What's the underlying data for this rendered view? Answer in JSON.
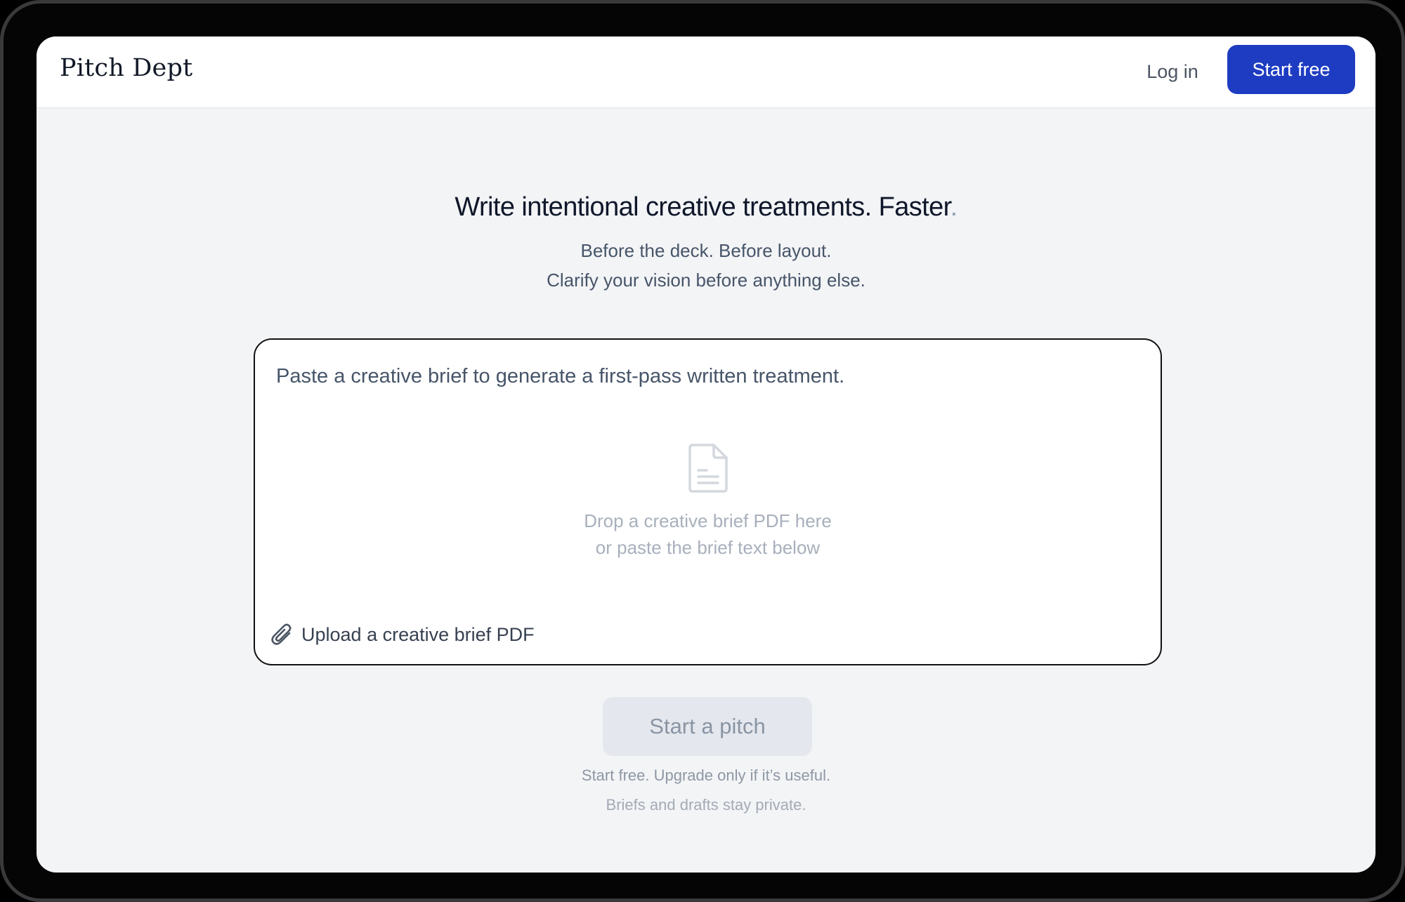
{
  "header": {
    "brand": "Pitch Dept",
    "login_label": "Log in",
    "start_free_label": "Start free"
  },
  "hero": {
    "headline": "Write intentional creative treatments. Faster",
    "headline_dot": ".",
    "subline_1": "Before the deck. Before layout.",
    "subline_2": "Clarify your vision before anything else."
  },
  "brief": {
    "placeholder": "Paste a creative brief to generate a first-pass written treatment.",
    "value": "",
    "drop_line_1": "Drop a creative brief PDF here",
    "drop_line_2": "or paste the brief text below",
    "upload_label": "Upload a creative brief PDF",
    "doc_icon": "document-icon",
    "upload_icon": "paperclip-icon"
  },
  "cta": {
    "start_pitch_label": "Start a pitch",
    "note_1": "Start free. Upgrade only if it’s useful.",
    "note_2": "Briefs and drafts stay private."
  },
  "colors": {
    "accent": "#1e3cc1",
    "background": "#f3f4f6",
    "disabled_button": "#e4e8ee"
  }
}
